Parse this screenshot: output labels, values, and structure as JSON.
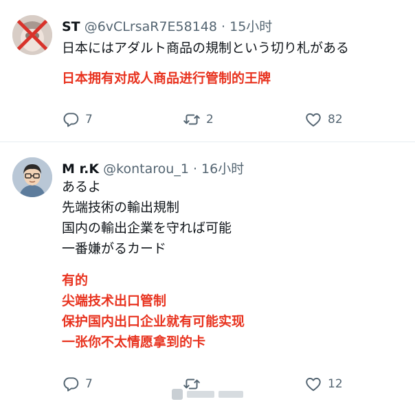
{
  "tweets": [
    {
      "name": "ST",
      "handle": "@6vCLrsaR7E58148",
      "separator": "·",
      "time": "15小时",
      "lines": [
        "日本にはアダルト商品の規制という切り札がある"
      ],
      "translation_lines": [
        "日本拥有对成人商品进行管制的王牌"
      ],
      "replies": "7",
      "retweets": "2",
      "likes": "82"
    },
    {
      "name": "M r.K",
      "handle": "@kontarou_1",
      "separator": "·",
      "time": "16小时",
      "lines": [
        "あるよ",
        "先端技術の輸出規制",
        "国内の輸出企業を守れば可能",
        "一番嫌がるカード"
      ],
      "translation_lines": [
        "有的",
        "尖端技术出口管制",
        "保护国内出口企业就有可能实现",
        "一张你不太情愿拿到的卡"
      ],
      "replies": "7",
      "retweets": "",
      "likes": "12"
    }
  ],
  "icons": {
    "reply": "reply-icon",
    "retweet": "retweet-icon",
    "like": "like-icon"
  },
  "colors": {
    "translation": "#e8331f",
    "secondary_text": "#536471",
    "divider": "#e6ecf0"
  }
}
